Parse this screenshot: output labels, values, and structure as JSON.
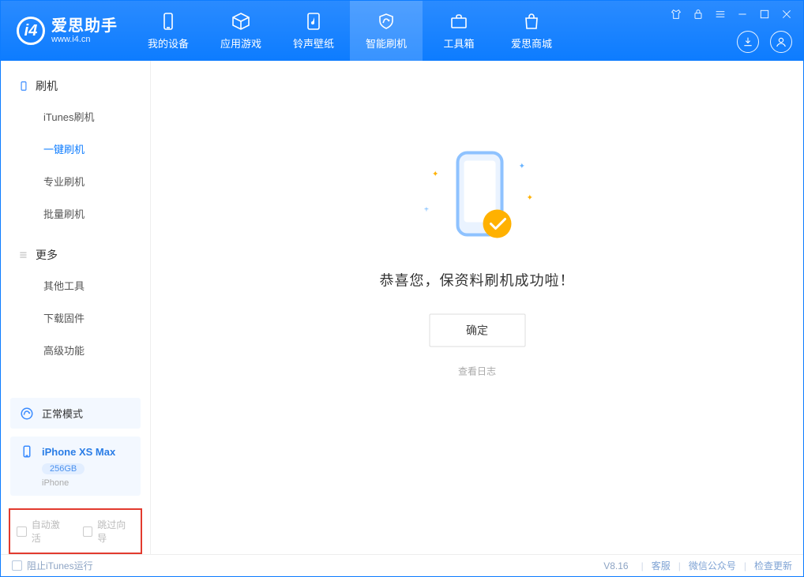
{
  "app": {
    "name": "爱思助手",
    "url": "www.i4.cn"
  },
  "topTabs": [
    {
      "label": "我的设备"
    },
    {
      "label": "应用游戏"
    },
    {
      "label": "铃声壁纸"
    },
    {
      "label": "智能刷机",
      "active": true
    },
    {
      "label": "工具箱"
    },
    {
      "label": "爱思商城"
    }
  ],
  "sidebar": {
    "group1": {
      "head": "刷机",
      "items": [
        "iTunes刷机",
        "一键刷机",
        "专业刷机",
        "批量刷机"
      ],
      "activeIndex": 1
    },
    "group2": {
      "head": "更多",
      "items": [
        "其他工具",
        "下载固件",
        "高级功能"
      ]
    }
  },
  "mode": {
    "label": "正常模式"
  },
  "device": {
    "name": "iPhone XS Max",
    "capacity": "256GB",
    "type": "iPhone"
  },
  "redOptions": {
    "opt1": "自动激活",
    "opt2": "跳过向导"
  },
  "main": {
    "message": "恭喜您，保资料刷机成功啦！",
    "okLabel": "确定",
    "logLabel": "查看日志"
  },
  "footer": {
    "blockItunes": "阻止iTunes运行",
    "version": "V8.16",
    "links": [
      "客服",
      "微信公众号",
      "检查更新"
    ]
  }
}
